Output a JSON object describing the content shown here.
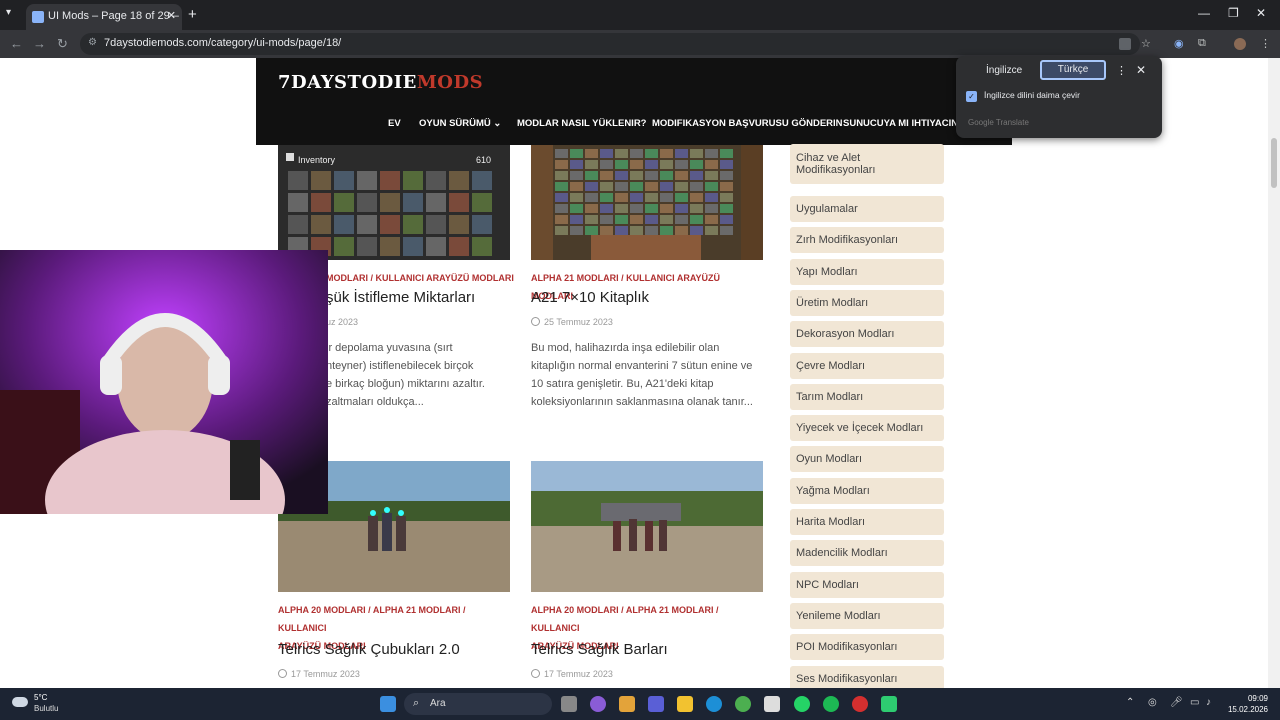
{
  "browser": {
    "tab_title": "UI Mods – Page 18 of 29 – 7 Da",
    "url": "7daystodiemods.com/category/ui-mods/page/18/"
  },
  "site": {
    "logo_main": "7DAYSTODIE",
    "logo_accent": "MODS",
    "nav": [
      "EV",
      "OYUN SÜRÜMÜ",
      "MODLAR NASIL YÜKLENIR?",
      "MODIFIKASYON BAŞVURUSU GÖNDERIN",
      "SUNUCUYA MI IHTIYACINIZ"
    ]
  },
  "translate": {
    "lang_source": "İngilizce",
    "lang_target": "Türkçe",
    "always_label": "İngilizce dilini daima çevir",
    "footer": "Google Translate"
  },
  "posts": [
    {
      "cats": "MODLARI / KULLANICI ARAYÜZÜ MODLARI",
      "title": "şük İstifleme Miktarları",
      "date": "uz 2023",
      "excerpt": [
        "ir depolama yuvasına (sırt",
        "nteyner) istiflenebilecek birçok",
        "e birkaç bloğun) miktarını azaltır.",
        "zaltmaları oldukça..."
      ]
    },
    {
      "cats": "ALPHA 21 MODLARI / KULLANICI ARAYÜZÜ MODLARI",
      "title": "A21 7×10 Kitaplık",
      "date": "25 Temmuz 2023",
      "excerpt": [
        "Bu mod, halihazırda inşa edilebilir olan",
        "kitaplığın normal envanterini 7 sütun enine ve",
        "10 satıra genişletir. Bu, A21'deki kitap",
        "koleksiyonlarının saklanmasına olanak tanır..."
      ]
    },
    {
      "cats1": "ALPHA 20 MODLARI / ALPHA 21 MODLARI / KULLANICI",
      "cats2": "ARAYÜZÜ MODLARI",
      "title": "Telrics Sağlık Çubukları 2.0",
      "date": "17 Temmuz 2023"
    },
    {
      "cats1": "ALPHA 20 MODLARI / ALPHA 21 MODLARI / KULLANICI",
      "cats2": "ARAYÜZÜ MODLARI",
      "title": "Telrics Sağlık Barları",
      "date": "17 Temmuz 2023"
    }
  ],
  "inventory_thumb": {
    "label": "Inventory",
    "count": "610"
  },
  "sidebar": [
    "Cihaz ve Alet Modifikasyonları",
    "Uygulamalar",
    "Zırh Modifikasyonları",
    "Yapı Modları",
    "Üretim Modları",
    "Dekorasyon Modları",
    "Çevre Modları",
    "Tarım Modları",
    "Yiyecek ve İçecek Modları",
    "Oyun Modları",
    "Yağma Modları",
    "Harita Modları",
    "Madencilik Modları",
    "NPC Modları",
    "Yenileme Modları",
    "POI Modifikasyonları",
    "Ses Modifikasyonları"
  ],
  "taskbar": {
    "temp": "5°C",
    "weather": "Bulutlu",
    "search": "Ara",
    "time": "09:09",
    "date": "15.02.2026"
  }
}
